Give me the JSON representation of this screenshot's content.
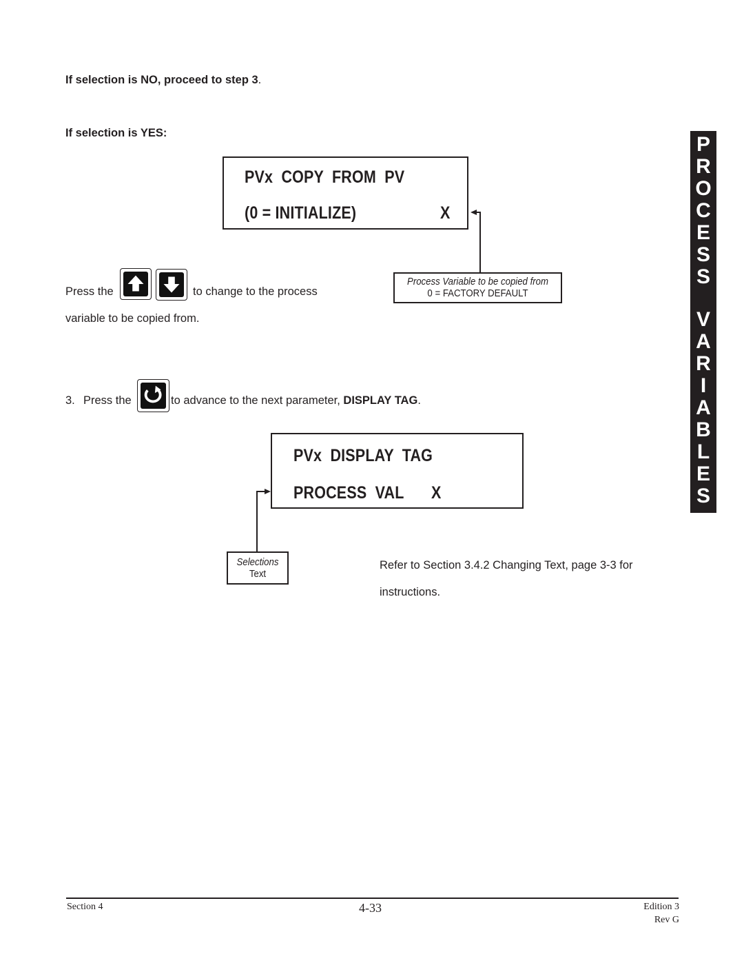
{
  "instructions": {
    "if_no": "If selection is NO, proceed to step 3",
    "if_no_period": ".",
    "if_yes": "If selection is YES:"
  },
  "display_copy": {
    "line1": "PVx  COPY  FROM  PV",
    "line2": "(0 = INITIALIZE)",
    "value": "X"
  },
  "callout_copy": {
    "line1": "Process Variable to be copied from",
    "line2": "0 = FACTORY DEFAULT"
  },
  "press_arrows": {
    "prefix": "Press the",
    "suffix": "to change to the process",
    "line2": "variable to be copied from.",
    "keys": [
      {
        "icon": "up-arrow-key-icon"
      },
      {
        "icon": "down-arrow-key-icon"
      }
    ]
  },
  "step3": {
    "number": "3.",
    "prefix": "Press the",
    "icon": "advance-cycle-key-icon",
    "suffix": "to advance to the next parameter,",
    "target": "DISPLAY TAG",
    "period": "."
  },
  "display_tag": {
    "line1": "PVx  DISPLAY  TAG",
    "line2": "PROCESS  VAL",
    "value": "X"
  },
  "callout_tag": {
    "line1": "Selections",
    "line2": "Text"
  },
  "refer": {
    "line1": "Refer to Section 3.4.2 Changing Text, page 3-3 for",
    "line2": "instructions."
  },
  "side_tab": {
    "letters": [
      "P",
      "R",
      "O",
      "C",
      "E",
      "S",
      "S",
      "V",
      "A",
      "R",
      "I",
      "A",
      "B",
      "L",
      "E",
      "S"
    ],
    "label": "PROCESS VARIABLES"
  },
  "footer": {
    "section": "Section 4",
    "page": "4-33",
    "edition": "Edition 3",
    "rev": "Rev G"
  }
}
